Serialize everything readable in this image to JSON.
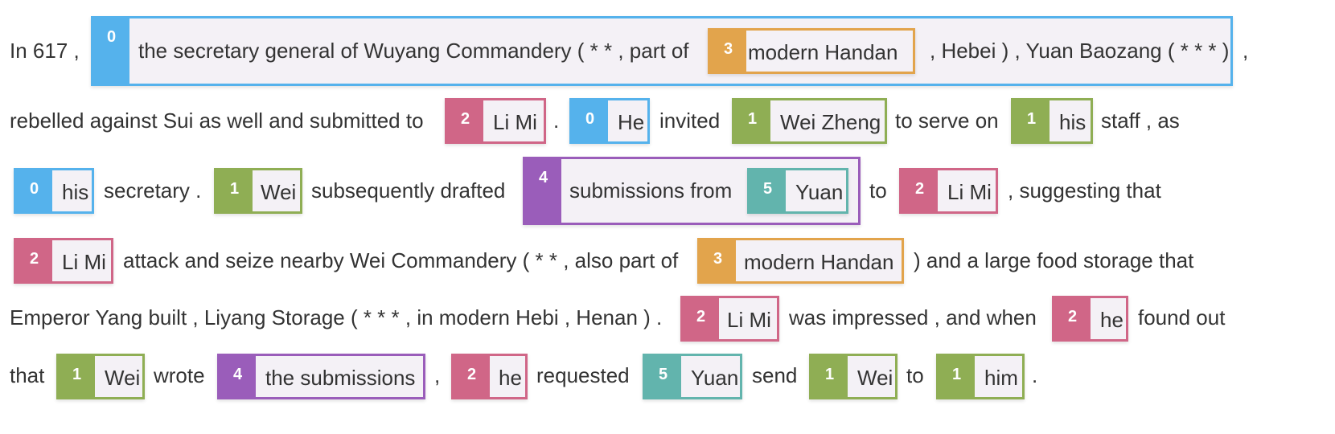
{
  "lines": [
    [
      {
        "type": "text",
        "text": "In 617 ,"
      },
      {
        "type": "mention",
        "cluster": "0",
        "children": [
          {
            "type": "text",
            "text": "the secretary general of Wuyang Commandery ( * * , part of"
          },
          {
            "type": "mention",
            "cluster": "3",
            "text": "modern Handan"
          },
          {
            "type": "text",
            "text": ", Hebei ) , Yuan Baozang ( * * * )"
          }
        ]
      },
      {
        "type": "text",
        "text": ","
      }
    ],
    [
      {
        "type": "text",
        "text": "rebelled against Sui as well and submitted to"
      },
      {
        "type": "mention",
        "cluster": "2",
        "text": "Li Mi"
      },
      {
        "type": "text",
        "text": "."
      },
      {
        "type": "mention",
        "cluster": "0",
        "text": "He"
      },
      {
        "type": "text",
        "text": "invited"
      },
      {
        "type": "mention",
        "cluster": "1",
        "text": "Wei Zheng"
      },
      {
        "type": "text",
        "text": "to serve on"
      },
      {
        "type": "mention",
        "cluster": "1",
        "text": "his"
      },
      {
        "type": "text",
        "text": "staff , as"
      }
    ],
    [
      {
        "type": "mention",
        "cluster": "0",
        "text": "his"
      },
      {
        "type": "text",
        "text": "secretary ."
      },
      {
        "type": "mention",
        "cluster": "1",
        "text": "Wei"
      },
      {
        "type": "text",
        "text": "subsequently drafted"
      },
      {
        "type": "mention",
        "cluster": "4",
        "children": [
          {
            "type": "text",
            "text": "submissions from"
          },
          {
            "type": "mention",
            "cluster": "5",
            "text": "Yuan"
          }
        ]
      },
      {
        "type": "text",
        "text": "to"
      },
      {
        "type": "mention",
        "cluster": "2",
        "text": "Li Mi"
      },
      {
        "type": "text",
        "text": ", suggesting that"
      }
    ],
    [
      {
        "type": "mention",
        "cluster": "2",
        "text": "Li Mi"
      },
      {
        "type": "text",
        "text": "attack and seize nearby Wei Commandery ( * * , also part of"
      },
      {
        "type": "mention",
        "cluster": "3",
        "text": "modern Handan"
      },
      {
        "type": "text",
        "text": ") and a large food storage that"
      }
    ],
    [
      {
        "type": "text",
        "text": "Emperor Yang built , Liyang Storage ( * * * , in modern Hebi , Henan ) ."
      },
      {
        "type": "mention",
        "cluster": "2",
        "text": "Li Mi"
      },
      {
        "type": "text",
        "text": "was impressed , and when"
      },
      {
        "type": "mention",
        "cluster": "2",
        "text": "he"
      },
      {
        "type": "text",
        "text": "found out"
      }
    ],
    [
      {
        "type": "text",
        "text": "that"
      },
      {
        "type": "mention",
        "cluster": "1",
        "text": "Wei"
      },
      {
        "type": "text",
        "text": "wrote"
      },
      {
        "type": "mention",
        "cluster": "4",
        "text": "the submissions"
      },
      {
        "type": "text",
        "text": ","
      },
      {
        "type": "mention",
        "cluster": "2",
        "text": "he"
      },
      {
        "type": "text",
        "text": "requested"
      },
      {
        "type": "mention",
        "cluster": "5",
        "text": "Yuan"
      },
      {
        "type": "text",
        "text": "send"
      },
      {
        "type": "mention",
        "cluster": "1",
        "text": "Wei"
      },
      {
        "type": "text",
        "text": "to"
      },
      {
        "type": "mention",
        "cluster": "1",
        "text": "him"
      },
      {
        "type": "text",
        "text": "."
      }
    ]
  ]
}
